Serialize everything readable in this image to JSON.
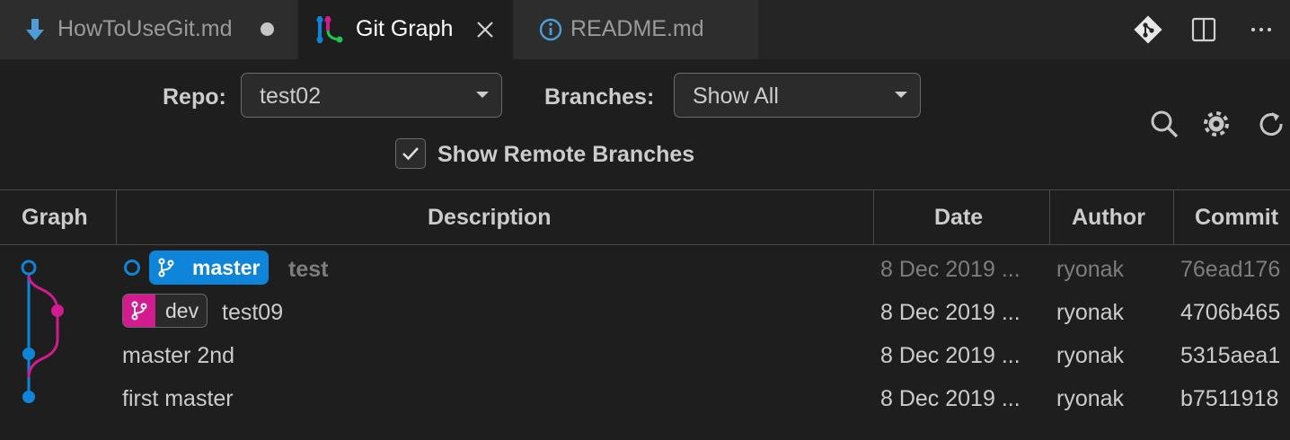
{
  "tabs": [
    {
      "label": "HowToUseGit.md",
      "icon": "download-arrow-icon",
      "state": "unsaved"
    },
    {
      "label": "Git Graph",
      "icon": "git-graph-icon",
      "state": "active"
    },
    {
      "label": "README.md",
      "icon": "info-icon",
      "state": "inactive"
    }
  ],
  "toolbar_icons": [
    "git-icon",
    "split-editor-icon",
    "more-actions-icon"
  ],
  "controls": {
    "repo_label": "Repo:",
    "repo_value": "test02",
    "branches_label": "Branches:",
    "branches_value": "Show All",
    "show_remote_label": "Show Remote Branches",
    "show_remote_checked": true,
    "icons": [
      "search-icon",
      "settings-gear-icon",
      "refresh-icon"
    ]
  },
  "table": {
    "headers": {
      "graph": "Graph",
      "description": "Description",
      "date": "Date",
      "author": "Author",
      "commit": "Commit"
    },
    "rows": [
      {
        "branch": "master",
        "description": "test",
        "date": "8 Dec 2019 ...",
        "author": "ryonak",
        "commit": "76ead176",
        "uncommitted_head": true
      },
      {
        "branch": "dev",
        "description": "test09",
        "date": "8 Dec 2019 ...",
        "author": "ryonak",
        "commit": "4706b465"
      },
      {
        "branch": "",
        "description": "master 2nd",
        "date": "8 Dec 2019 ...",
        "author": "ryonak",
        "commit": "5315aea1"
      },
      {
        "branch": "",
        "description": "first master",
        "date": "8 Dec 2019 ...",
        "author": "ryonak",
        "commit": "b7511918"
      }
    ]
  },
  "colors": {
    "background": "#1e1e1e",
    "tab_bar": "#252526",
    "branch_master": "#0f85d9",
    "branch_dev": "#d11b8f",
    "text": "#cccccc",
    "text_dim": "#7d7d7d"
  }
}
